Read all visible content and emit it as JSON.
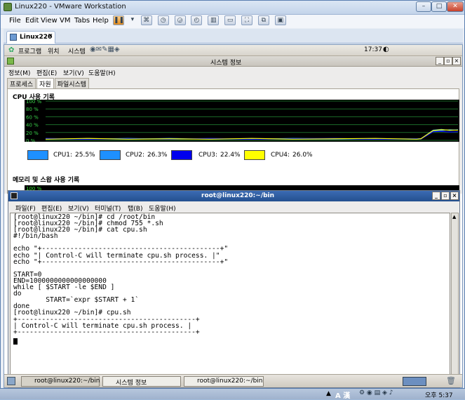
{
  "vm": {
    "title": "Linux220 - VMware Workstation",
    "menu": [
      "File",
      "Edit",
      "View",
      "VM",
      "Tabs",
      "Help"
    ],
    "tab_label": "Linux220"
  },
  "guest_panel": {
    "items": [
      "프로그램",
      "위치",
      "시스템"
    ],
    "clock": "17:37"
  },
  "sysmon": {
    "title": "시스템 정보",
    "menu": [
      "정보(M)",
      "편집(E)",
      "보기(V)",
      "도움말(H)"
    ],
    "tabs": [
      "프로세스",
      "자원",
      "파일시스템"
    ],
    "cpu_history_label": "CPU 사용 기록",
    "mem_history_label": "메모리 및 스왑 사용 기록",
    "ticks": [
      "100 %",
      "80 %",
      "60 %",
      "40 %",
      "20 %",
      "0 %"
    ],
    "mem_tick": "100 %",
    "cpus": [
      {
        "label": "CPU1:",
        "value": "25.5%",
        "color": "#1e90ff"
      },
      {
        "label": "CPU2:",
        "value": "26.3%",
        "color": "#1e90ff"
      },
      {
        "label": "CPU3:",
        "value": "22.4%",
        "color": "#0000ee"
      },
      {
        "label": "CPU4:",
        "value": "26.0%",
        "color": "#ffff00"
      }
    ]
  },
  "chart_data": {
    "type": "line",
    "title": "CPU 사용 기록",
    "ylim": [
      0,
      100
    ],
    "grid": true,
    "x": [
      0,
      10,
      20,
      30,
      40,
      50,
      60,
      70,
      80,
      90,
      91,
      94,
      96,
      98,
      100
    ],
    "series": [
      {
        "name": "CPU1:",
        "color": "#1e90ff",
        "values": [
          4,
          3,
          5,
          3,
          4,
          3,
          5,
          4,
          3,
          4,
          4,
          24,
          25,
          27,
          26
        ]
      },
      {
        "name": "CPU2:",
        "color": "#1e90ff",
        "values": [
          3,
          4,
          3,
          5,
          3,
          4,
          3,
          3,
          4,
          3,
          4,
          26,
          28,
          25,
          27
        ]
      },
      {
        "name": "CPU3:",
        "color": "#0000ee",
        "values": [
          5,
          3,
          4,
          3,
          5,
          3,
          4,
          5,
          3,
          4,
          3,
          22,
          23,
          21,
          22
        ]
      },
      {
        "name": "CPU4:",
        "color": "#ffff00",
        "values": [
          3,
          5,
          3,
          4,
          3,
          5,
          3,
          4,
          5,
          3,
          4,
          25,
          27,
          26,
          26
        ]
      }
    ]
  },
  "terminal": {
    "title": "root@linux220:~/bin",
    "menu": [
      "파일(F)",
      "편집(E)",
      "보기(V)",
      "터미널(T)",
      "탭(B)",
      "도움말(H)"
    ],
    "lines": [
      "[root@linux220 ~/bin]# cd /root/bin",
      "[root@linux220 ~/bin]# chmod 755 *.sh",
      "[root@linux220 ~/bin]# cat cpu.sh",
      "#!/bin/bash",
      "",
      "echo \"+--------------------------------------------+\"",
      "echo \"| Control-C will terminate cpu.sh process. |\"",
      "echo \"+--------------------------------------------+\"",
      "",
      "START=0",
      "END=1000000000000000000",
      "while [ $START -le $END ]",
      "do",
      "        START=`expr $START + 1`",
      "done",
      "[root@linux220 ~/bin]# cpu.sh",
      "+--------------------------------------------+",
      "| Control-C will terminate cpu.sh process. |",
      "+--------------------------------------------+"
    ]
  },
  "guest_taskbar": {
    "tasks": [
      "root@linux220:~/bin",
      "시스템 정보",
      "root@linux220:~/bin"
    ]
  },
  "host_tray": {
    "ime": "A 漢",
    "clock": "오후 5:37"
  }
}
